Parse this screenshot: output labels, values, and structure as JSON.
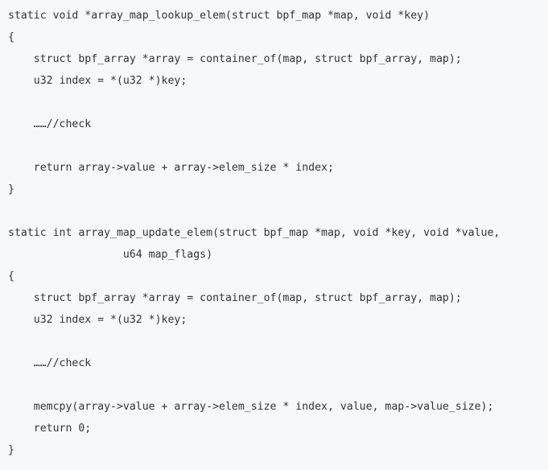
{
  "code": {
    "lines": [
      "static void *array_map_lookup_elem(struct bpf_map *map, void *key)",
      "{",
      "    struct bpf_array *array = container_of(map, struct bpf_array, map);",
      "    u32 index = *(u32 *)key;",
      "",
      "    ……//check",
      "",
      "    return array->value + array->elem_size * index;",
      "}",
      "",
      "static int array_map_update_elem(struct bpf_map *map, void *key, void *value,",
      "                  u64 map_flags)",
      "{",
      "    struct bpf_array *array = container_of(map, struct bpf_array, map);",
      "    u32 index = *(u32 *)key;",
      "",
      "    ……//check",
      "",
      "    memcpy(array->value + array->elem_size * index, value, map->value_size);",
      "    return 0;",
      "}"
    ]
  }
}
